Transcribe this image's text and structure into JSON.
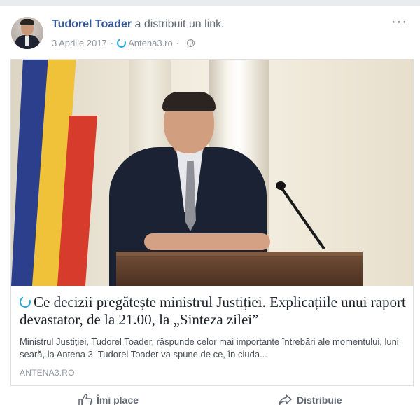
{
  "post": {
    "author": "Tudorel Toader",
    "action": "a distribuit un link.",
    "date": "3 Aprilie 2017",
    "separator": "·",
    "source": "Antena3.ro",
    "menu": "···"
  },
  "link": {
    "title": "Ce decizii pregătește ministrul Justiției. Explicațiile unui raport devastator, de la 21.00, la „Sinteza zilei”",
    "description": "Ministrul Justiției, Tudorel Toader, răspunde celor mai importante întrebări ale momentului, luni seară, la Antena 3. Tudorel Toader va spune de ce, în ciuda...",
    "domain": "ANTENA3.RO"
  },
  "actions": {
    "like_label": "Îmi place",
    "share_label": "Distribuie"
  },
  "colors": {
    "author": "#365899",
    "source_icon": "#29a9e0",
    "background": "#e9ebee"
  }
}
